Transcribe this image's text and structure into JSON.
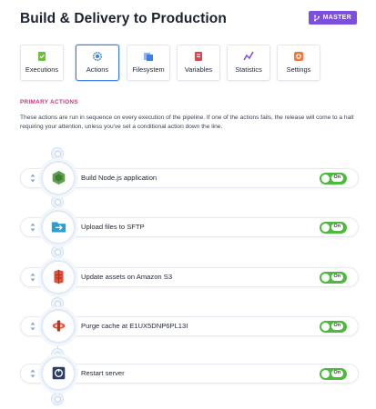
{
  "header": {
    "title": "Build & Delivery to Production",
    "branch": "MASTER"
  },
  "tabs": [
    {
      "label": "Executions",
      "icon": "executions-icon",
      "active": false
    },
    {
      "label": "Actions",
      "icon": "actions-gear-icon",
      "active": true
    },
    {
      "label": "Filesystem",
      "icon": "filesystem-icon",
      "active": false
    },
    {
      "label": "Variables",
      "icon": "variables-icon",
      "active": false
    },
    {
      "label": "Statistics",
      "icon": "statistics-icon",
      "active": false
    },
    {
      "label": "Settings",
      "icon": "settings-icon",
      "active": false
    }
  ],
  "section": {
    "title": "PRIMARY ACTIONS",
    "description": "These actions are run in sequence on every execution of the pipeline. If one of the actions fails, the release will come to a halt requiring your attention, unless you've set a conditional action down the line."
  },
  "actions": [
    {
      "label": "Build Node.js application",
      "icon": "nodejs-icon",
      "toggle": "On",
      "enabled": true
    },
    {
      "label": "Upload files to SFTP",
      "icon": "sftp-folder-icon",
      "toggle": "On",
      "enabled": true
    },
    {
      "label": "Update assets on Amazon S3",
      "icon": "amazon-s3-icon",
      "toggle": "On",
      "enabled": true
    },
    {
      "label": "Purge cache at E1UX5DNP6PL13I",
      "icon": "cloudfront-icon",
      "toggle": "On",
      "enabled": true
    },
    {
      "label": "Restart server",
      "icon": "server-icon",
      "toggle": "On",
      "enabled": true
    }
  ],
  "colors": {
    "accent": "#3d7ee8",
    "branch_badge": "#7d4fe0",
    "section_title": "#c7397f",
    "toggle_on": "#4cbb3c"
  }
}
